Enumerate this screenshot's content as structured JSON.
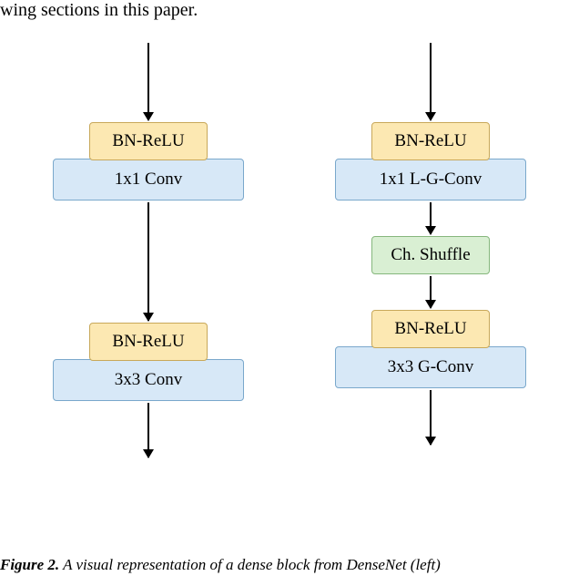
{
  "top_fragment": "wing sections in this paper.",
  "left": {
    "block1_top": "BN-ReLU",
    "block1_bot": "1x1 Conv",
    "block2_top": "BN-ReLU",
    "block2_bot": "3x3 Conv"
  },
  "right": {
    "block1_top": "BN-ReLU",
    "block1_bot": "1x1 L-G-Conv",
    "shuffle": "Ch. Shuffle",
    "block2_top": "BN-ReLU",
    "block2_bot": "3x3 G-Conv"
  },
  "caption": {
    "label": "Figure 2.",
    "text": "A visual representation of a dense block from DenseNet (left)"
  },
  "chart_data": {
    "type": "diagram",
    "description": "Comparison of two network block architectures side by side",
    "left_column": [
      {
        "node": "input",
        "arrow_to_next": true
      },
      {
        "node": "BN-ReLU + 1x1 Conv",
        "style": "yellow-on-blue"
      },
      {
        "node": "arrow"
      },
      {
        "node": "BN-ReLU + 3x3 Conv",
        "style": "yellow-on-blue"
      },
      {
        "node": "output arrow"
      }
    ],
    "right_column": [
      {
        "node": "input",
        "arrow_to_next": true
      },
      {
        "node": "BN-ReLU + 1x1 L-G-Conv",
        "style": "yellow-on-blue"
      },
      {
        "node": "arrow"
      },
      {
        "node": "Ch. Shuffle",
        "style": "green"
      },
      {
        "node": "arrow"
      },
      {
        "node": "BN-ReLU + 3x3 G-Conv",
        "style": "yellow-on-blue"
      },
      {
        "node": "output arrow"
      }
    ]
  }
}
